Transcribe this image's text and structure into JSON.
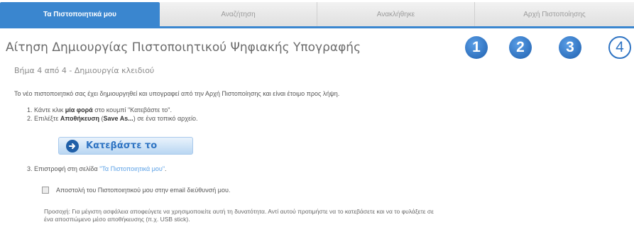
{
  "tabs": [
    {
      "label": "Τα Πιστοποιητικά μου",
      "active": true
    },
    {
      "label": "Αναζήτηση",
      "active": false
    },
    {
      "label": "Ανακλήθηκε",
      "active": false
    },
    {
      "label": "Αρχή Πιστοποίησης",
      "active": false
    }
  ],
  "page_title": "Αίτηση Δημιουργίας Πιστοποιητικού Ψηφιακής Υπογραφής",
  "steps": [
    "1",
    "2",
    "3",
    "4"
  ],
  "current_step": 4,
  "subtitle": "Βήμα 4 από 4 - Δημιουργία κλειδιού",
  "intro": "Το νέο πιστοποιητικό σας έχει δημιουργηθεί και υπογραφεί από την Αρχή Πιστοποίησης και είναι έτοιμο προς λήψη.",
  "instructions": {
    "item1": {
      "num": "1.",
      "pre": "Κάντε κλικ ",
      "bold": "μία φορά",
      "post": " στο κουμπί \"Κατεβάστε το\"."
    },
    "item2": {
      "num": "2.",
      "pre": "Επιλέξτε ",
      "bold": "Αποθήκευση",
      "mid": " (",
      "bold2": "Save As...",
      "post": ") σε ένα τοπικό αρχείο."
    }
  },
  "download_button": {
    "label": "Κατεβάστε το",
    "icon": "download-arrow-icon"
  },
  "step3": {
    "num": "3.",
    "pre": "Επιστροφή στη σελίδα ",
    "link": "\"Τα Πιστοποιητικά μου\"",
    "post": "."
  },
  "email_checkbox": {
    "label": "Αποστολή του Πιστοποιητικού μου στην email διεύθυνσή μου.",
    "checked": false
  },
  "note": {
    "line1": "Προσοχή: Για μέγιστη ασφάλεια αποφεύγετε να χρησιμοποιείτε αυτή τη δυνατότητα. Αντί αυτού προτιμήστε να το κατεβάσετε και να το φυλάξετε σε",
    "line2": "ένα αποσπώμενο μέσο αποθήκευσης (π.χ. USB stick)."
  },
  "colors": {
    "accent": "#3a86cf",
    "link": "#5aa0e6",
    "step_fill": "#2f74c3"
  }
}
